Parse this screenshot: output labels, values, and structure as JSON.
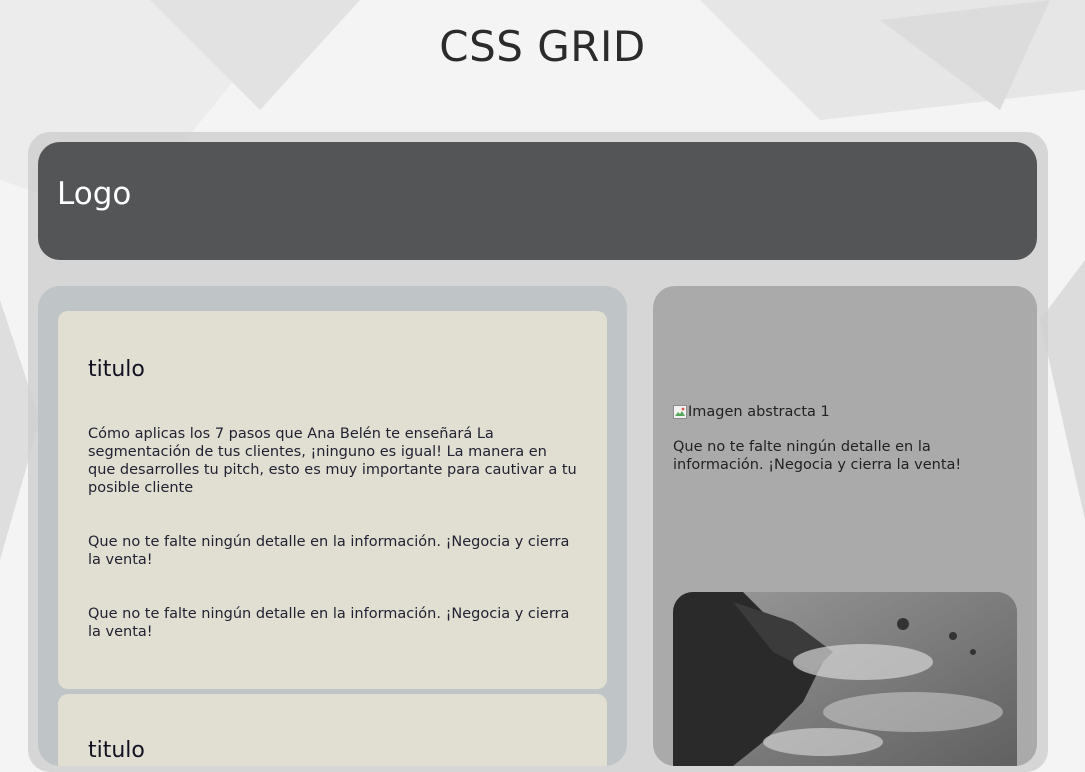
{
  "page": {
    "title": "CSS GRID"
  },
  "header": {
    "logo": "Logo"
  },
  "main": {
    "cards": [
      {
        "title": "titulo",
        "paragraphs": [
          "Cómo aplicas los 7 pasos que Ana Belén te enseñará La segmentación de tus clientes, ¡ninguno es igual! La manera en que desarrolles tu pitch, esto es muy importante para cautivar a tu posible cliente",
          "Que no te falte ningún detalle en la información. ¡Negocia y cierra la venta!",
          "Que no te falte ningún detalle en la información. ¡Negocia y cierra la venta!"
        ]
      },
      {
        "title": "titulo"
      }
    ]
  },
  "aside": {
    "image_alt": "Imagen abstracta 1",
    "text": "Que no te falte ningún detalle en la información. ¡Negocia y cierra la venta!"
  },
  "colors": {
    "header_bg": "#535557",
    "main_col_bg": "#bfc5c6",
    "card_bg": "#e0dfd2",
    "aside_bg": "#aaaaaa",
    "grid_bg": "#d0d0d0"
  }
}
